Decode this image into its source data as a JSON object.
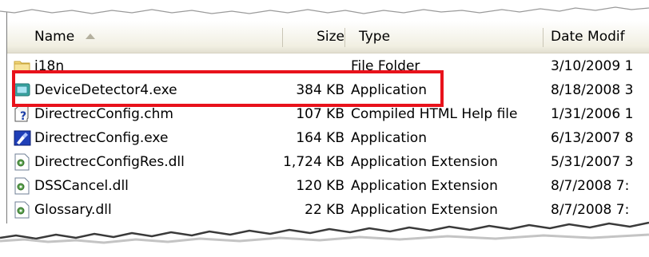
{
  "columns": {
    "name": "Name",
    "size": "Size",
    "type": "Type",
    "date": "Date Modif"
  },
  "files": [
    {
      "name": "i18n",
      "size": "",
      "type": "File Folder",
      "date": "3/10/2009 1",
      "icon": "folder-icon"
    },
    {
      "name": "DeviceDetector4.exe",
      "size": "384 KB",
      "type": "Application",
      "date": "8/18/2008 3",
      "icon": "application-window-icon",
      "highlighted": true
    },
    {
      "name": "DirectrecConfig.chm",
      "size": "107 KB",
      "type": "Compiled HTML Help file",
      "date": "1/31/2006 1",
      "icon": "help-file-icon"
    },
    {
      "name": "DirectrecConfig.exe",
      "size": "164 KB",
      "type": "Application",
      "date": "6/13/2007 8",
      "icon": "config-app-icon"
    },
    {
      "name": "DirectrecConfigRes.dll",
      "size": "1,724 KB",
      "type": "Application Extension",
      "date": "5/31/2007 3",
      "icon": "dll-icon"
    },
    {
      "name": "DSSCancel.dll",
      "size": "120 KB",
      "type": "Application Extension",
      "date": "8/7/2008 7:",
      "icon": "dll-icon"
    },
    {
      "name": "Glossary.dll",
      "size": "22 KB",
      "type": "Application Extension",
      "date": "8/7/2008 7:",
      "icon": "dll-icon"
    }
  ],
  "colors": {
    "highlight": "#e8121b",
    "header_bg": "#f1efe2"
  }
}
